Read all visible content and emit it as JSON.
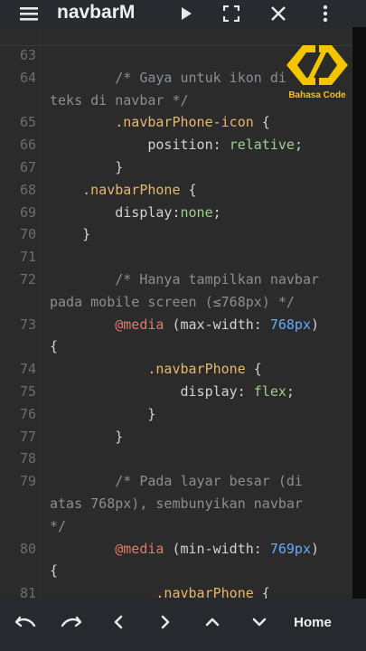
{
  "header": {
    "title": "navbarM",
    "menu_icon": "hamburger-menu-icon",
    "run_icon": "play-icon",
    "fullscreen_icon": "fullscreen-icon",
    "close_icon": "close-icon",
    "more_icon": "more-vertical-icon"
  },
  "watermark": {
    "text": "Bahasa Code",
    "icon": "code-brackets-logo"
  },
  "editor": {
    "rows": [
      {
        "ln": "63"
      },
      {
        "ln": "64",
        "indent": "        ",
        "comment": "/* Gaya untuk ikon di"
      },
      {
        "ln": "",
        "comment": "teks di navbar */"
      },
      {
        "ln": "65",
        "indent": "        ",
        "selector": ".navbarPhone-icon",
        "tail": " {"
      },
      {
        "ln": "66",
        "indent": "            ",
        "prop": "position: ",
        "value": "relative",
        "tail": ";"
      },
      {
        "ln": "67",
        "indent": "        ",
        "tail": "}"
      },
      {
        "ln": "68",
        "indent": "    ",
        "selector": ".navbarPhone",
        "tail": " {"
      },
      {
        "ln": "69",
        "indent": "        ",
        "prop": "display:",
        "value": "none",
        "tail": ";"
      },
      {
        "ln": "70",
        "indent": "    ",
        "tail": "}"
      },
      {
        "ln": "71"
      },
      {
        "ln": "72",
        "indent": "        ",
        "comment": "/* Hanya tampilkan navbar"
      },
      {
        "ln": "",
        "comment": "pada mobile screen (≤768px) */"
      },
      {
        "ln": "73",
        "indent": "        ",
        "at": "@media",
        "prop": " (max-width: ",
        "num": "768px",
        "tail": ")"
      },
      {
        "ln": "",
        "tail": "{"
      },
      {
        "ln": "74",
        "indent": "            ",
        "selector": ".navbarPhone",
        "tail": " {"
      },
      {
        "ln": "75",
        "indent": "                ",
        "prop": "display: ",
        "value": "flex",
        "tail": ";"
      },
      {
        "ln": "76",
        "indent": "            ",
        "tail": "}"
      },
      {
        "ln": "77",
        "indent": "        ",
        "tail": "}"
      },
      {
        "ln": "78"
      },
      {
        "ln": "79",
        "indent": "        ",
        "comment": "/* Pada layar besar (di"
      },
      {
        "ln": "",
        "comment": "atas 768px), sembunyikan navbar"
      },
      {
        "ln": "",
        "comment": "*/"
      },
      {
        "ln": "80",
        "indent": "        ",
        "at": "@media",
        "prop": " (min-width: ",
        "num": "769px",
        "tail": ")"
      },
      {
        "ln": "",
        "tail": "{"
      },
      {
        "ln": "81",
        "indent": "             ",
        "selector": ".navbarPhone",
        "tail": " {"
      }
    ]
  },
  "bottom": {
    "undo_icon": "undo-icon",
    "redo_icon": "redo-icon",
    "left_icon": "arrow-left-icon",
    "right_icon": "arrow-right-icon",
    "up_icon": "arrow-up-icon",
    "down_icon": "arrow-down-icon",
    "home_label": "Home"
  }
}
